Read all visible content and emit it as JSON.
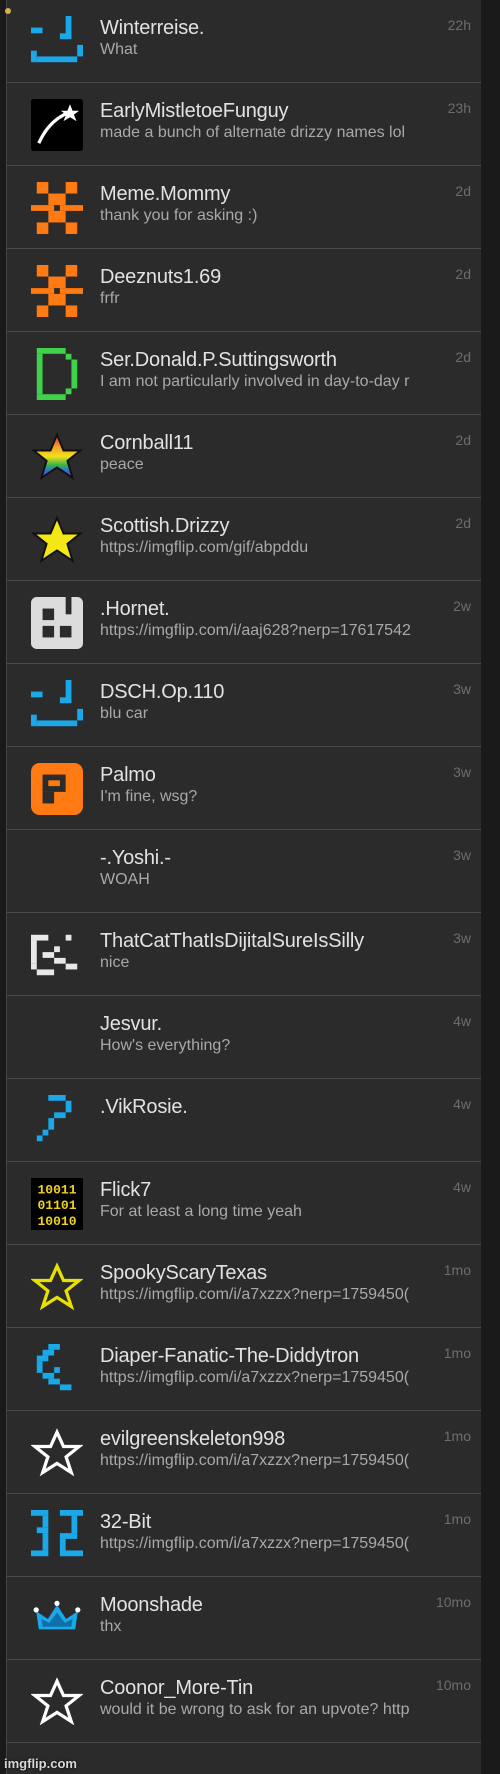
{
  "conversations": [
    {
      "name": "Winterreise.",
      "message": "What",
      "time": "22h",
      "avatar_icon": "blue-smiley-icon",
      "avatar_color": "#1aa8e8"
    },
    {
      "name": "EarlyMistletoeFunguy",
      "message": "made a bunch of alternate drizzy names lol",
      "time": "23h",
      "avatar_icon": "shooting-star-icon",
      "avatar_color": "#ffffff"
    },
    {
      "name": "Meme.Mommy",
      "message": "thank you for asking :)",
      "time": "2d",
      "avatar_icon": "orange-pixel-icon",
      "avatar_color": "#ff7a12"
    },
    {
      "name": "Deeznuts1.69",
      "message": "frfr",
      "time": "2d",
      "avatar_icon": "orange-pixel-icon",
      "avatar_color": "#ff7a12"
    },
    {
      "name": "Ser.Donald.P.Suttingsworth",
      "message": "I am not particularly involved in day-to-day r",
      "time": "2d",
      "avatar_icon": "green-d-icon",
      "avatar_color": "#3fd24a"
    },
    {
      "name": "Cornball11",
      "message": "peace",
      "time": "2d",
      "avatar_icon": "rainbow-star-icon",
      "avatar_color": "#e03a3a"
    },
    {
      "name": "Scottish.Drizzy",
      "message": "https://imgflip.com/gif/abpddu",
      "time": "2d",
      "avatar_icon": "yellow-star-icon",
      "avatar_color": "#f5e616"
    },
    {
      "name": ".Hornet.",
      "message": "https://imgflip.com/i/aaj628?nerp=17617542",
      "time": "2w",
      "avatar_icon": "gray-pixel-icon",
      "avatar_color": "#dcdcdc"
    },
    {
      "name": "DSCH.Op.110",
      "message": "blu car",
      "time": "3w",
      "avatar_icon": "blue-smiley-icon",
      "avatar_color": "#1aa8e8"
    },
    {
      "name": "Palmo",
      "message": "I'm fine, wsg?",
      "time": "3w",
      "avatar_icon": "orange-p-icon",
      "avatar_color": "#ff7a12"
    },
    {
      "name": "-.Yoshi.-",
      "message": "WOAH",
      "time": "3w",
      "avatar_icon": "blank-icon",
      "avatar_color": "#2b2b2b"
    },
    {
      "name": "ThatCatThatIsDijitalSureIsSilly",
      "message": "nice",
      "time": "3w",
      "avatar_icon": "white-pixel-icon",
      "avatar_color": "#e8e8e8"
    },
    {
      "name": "Jesvur.",
      "message": "How's everything?",
      "time": "4w",
      "avatar_icon": "blank-icon",
      "avatar_color": "#2b2b2b"
    },
    {
      "name": ".VikRosie.",
      "message": "",
      "time": "4w",
      "avatar_icon": "blue-question-icon",
      "avatar_color": "#1aa8e8"
    },
    {
      "name": "Flick7",
      "message": "For at least a long time yeah",
      "time": "4w",
      "avatar_icon": "binary-icon",
      "avatar_color": "#f0d21c"
    },
    {
      "name": "SpookyScaryTexas",
      "message": "https://imgflip.com/i/a7xzzx?nerp=1759450(",
      "time": "1mo",
      "avatar_icon": "yellow-outline-star-icon",
      "avatar_color": "#e8e000"
    },
    {
      "name": "Diaper-Fanatic-The-Diddytron",
      "message": "https://imgflip.com/i/a7xzzx?nerp=1759450(",
      "time": "1mo",
      "avatar_icon": "blue-pixel-icon",
      "avatar_color": "#1aa8e8"
    },
    {
      "name": "evilgreenskeleton998",
      "message": "https://imgflip.com/i/a7xzzx?nerp=1759450(",
      "time": "1mo",
      "avatar_icon": "white-outline-star-icon",
      "avatar_color": "#ffffff"
    },
    {
      "name": "32-Bit",
      "message": "https://imgflip.com/i/a7xzzx?nerp=1759450(",
      "time": "1mo",
      "avatar_icon": "blue-32-icon",
      "avatar_color": "#1aa8e8"
    },
    {
      "name": "Moonshade",
      "message": "thx",
      "time": "10mo",
      "avatar_icon": "blue-crown-icon",
      "avatar_color": "#1aa8e8"
    },
    {
      "name": "Coonor_More-Tin",
      "message": "would it be wrong to ask for an upvote? http",
      "time": "10mo",
      "avatar_icon": "white-outline-star-icon",
      "avatar_color": "#ffffff"
    }
  ],
  "watermark": "imgflip.com"
}
